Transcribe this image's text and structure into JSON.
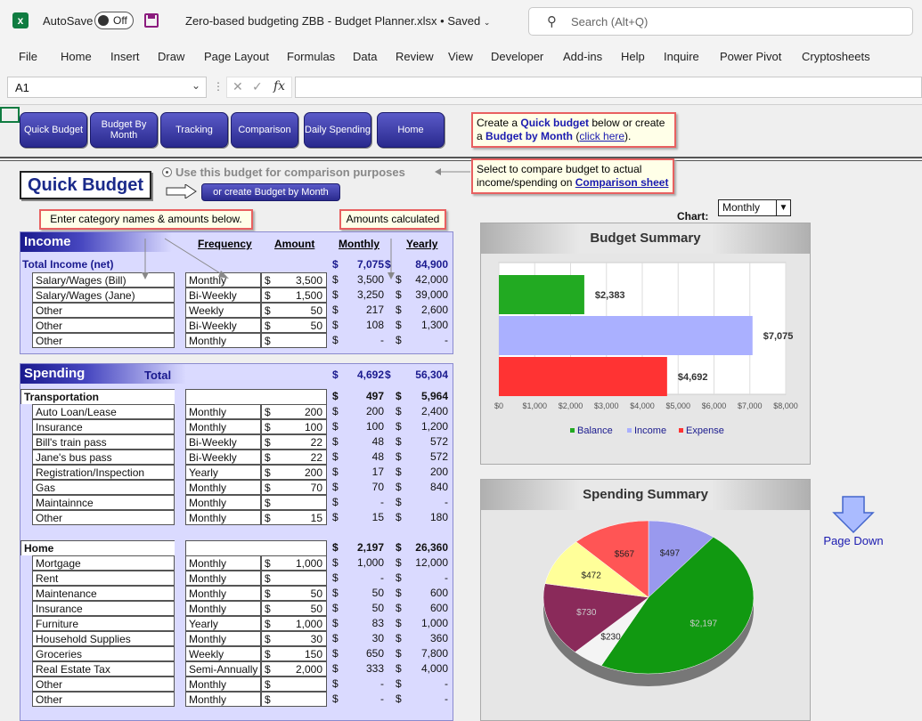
{
  "app": {
    "autosave_label": "AutoSave",
    "autosave_state": "Off",
    "doc_title": "Zero-based budgeting ZBB - Budget Planner.xlsx • Saved",
    "search_placeholder": "Search (Alt+Q)"
  },
  "menu": [
    "File",
    "Home",
    "Insert",
    "Draw",
    "Page Layout",
    "Formulas",
    "Data",
    "Review",
    "View",
    "Developer",
    "Add-ins",
    "Help",
    "Inquire",
    "Power Pivot",
    "Cryptosheets"
  ],
  "formula_bar": {
    "name_box": "A1",
    "fx": "fx",
    "value": ""
  },
  "nav_buttons": [
    "Quick Budget",
    "Budget By Month",
    "Tracking",
    "Comparison",
    "Daily Spending",
    "Home"
  ],
  "notes": {
    "top_1": "Create a ",
    "top_quick": "Quick budget",
    "top_2": " below or create a",
    "top_bbm": "Budget by Month",
    "top_3": " (",
    "top_link": "click here",
    "top_4": ").",
    "compare_1": "Select to compare budget to actual income/spending on ",
    "compare_link": "Comparison sheet",
    "enter_names": "Enter category names & amounts below.",
    "amounts_calc": "Amounts calculated"
  },
  "quick_budget": {
    "title": "Quick Budget",
    "radio_label": "Use this budget for comparison purposes",
    "create_btn": "or create Budget by Month"
  },
  "columns": {
    "frequency": "Frequency",
    "amount": "Amount",
    "monthly": "Monthly",
    "yearly": "Yearly"
  },
  "currency": "$",
  "income": {
    "title": "Income",
    "total_label": "Total Income (net)",
    "total_monthly": "7,075",
    "total_yearly": "84,900",
    "rows": [
      {
        "name": "Salary/Wages (Bill)",
        "freq": "Monthly",
        "amount": "3,500",
        "monthly": "3,500",
        "yearly": "42,000"
      },
      {
        "name": "Salary/Wages (Jane)",
        "freq": "Bi-Weekly",
        "amount": "1,500",
        "monthly": "3,250",
        "yearly": "39,000"
      },
      {
        "name": "Other",
        "freq": "Weekly",
        "amount": "50",
        "monthly": "217",
        "yearly": "2,600"
      },
      {
        "name": "Other",
        "freq": "Bi-Weekly",
        "amount": "50",
        "monthly": "108",
        "yearly": "1,300"
      },
      {
        "name": "Other",
        "freq": "Monthly",
        "amount": "",
        "monthly": "-",
        "yearly": "-"
      }
    ]
  },
  "spending": {
    "title": "Spending",
    "total_label": "Total",
    "total_monthly": "4,692",
    "total_yearly": "56,304",
    "transportation": {
      "label": "Transportation",
      "monthly": "497",
      "yearly": "5,964",
      "rows": [
        {
          "name": "Auto Loan/Lease",
          "freq": "Monthly",
          "amount": "200",
          "monthly": "200",
          "yearly": "2,400"
        },
        {
          "name": "Insurance",
          "freq": "Monthly",
          "amount": "100",
          "monthly": "100",
          "yearly": "1,200"
        },
        {
          "name": "Bill's train pass",
          "freq": "Bi-Weekly",
          "amount": "22",
          "monthly": "48",
          "yearly": "572"
        },
        {
          "name": "Jane's bus pass",
          "freq": "Bi-Weekly",
          "amount": "22",
          "monthly": "48",
          "yearly": "572"
        },
        {
          "name": "Registration/Inspection",
          "freq": "Yearly",
          "amount": "200",
          "monthly": "17",
          "yearly": "200"
        },
        {
          "name": "Gas",
          "freq": "Monthly",
          "amount": "70",
          "monthly": "70",
          "yearly": "840"
        },
        {
          "name": "Maintainnce",
          "freq": "Monthly",
          "amount": "",
          "monthly": "-",
          "yearly": "-"
        },
        {
          "name": "Other",
          "freq": "Monthly",
          "amount": "15",
          "monthly": "15",
          "yearly": "180"
        }
      ]
    },
    "home": {
      "label": "Home",
      "monthly": "2,197",
      "yearly": "26,360",
      "rows": [
        {
          "name": "Mortgage",
          "freq": "Monthly",
          "amount": "1,000",
          "monthly": "1,000",
          "yearly": "12,000"
        },
        {
          "name": "Rent",
          "freq": "Monthly",
          "amount": "",
          "monthly": "-",
          "yearly": "-"
        },
        {
          "name": "Maintenance",
          "freq": "Monthly",
          "amount": "50",
          "monthly": "50",
          "yearly": "600"
        },
        {
          "name": "Insurance",
          "freq": "Monthly",
          "amount": "50",
          "monthly": "50",
          "yearly": "600"
        },
        {
          "name": "Furniture",
          "freq": "Yearly",
          "amount": "1,000",
          "monthly": "83",
          "yearly": "1,000"
        },
        {
          "name": "Household Supplies",
          "freq": "Monthly",
          "amount": "30",
          "monthly": "30",
          "yearly": "360"
        },
        {
          "name": "Groceries",
          "freq": "Weekly",
          "amount": "150",
          "monthly": "650",
          "yearly": "7,800"
        },
        {
          "name": "Real Estate Tax",
          "freq": "Semi-Annually",
          "amount": "2,000",
          "monthly": "333",
          "yearly": "4,000"
        },
        {
          "name": "Other",
          "freq": "Monthly",
          "amount": "",
          "monthly": "-",
          "yearly": "-"
        },
        {
          "name": "Other",
          "freq": "Monthly",
          "amount": "",
          "monthly": "-",
          "yearly": "-"
        }
      ]
    }
  },
  "chart_controls": {
    "label": "Chart:",
    "selected": "Monthly"
  },
  "page_down": "Page Down",
  "colors": {
    "balance": "#22aa22",
    "income": "#aab0ff",
    "expense": "#ff3333",
    "navy": "#1a1a8e"
  },
  "chart_data": [
    {
      "type": "bar",
      "title": "Budget Summary",
      "orientation": "horizontal",
      "categories": [
        "Balance",
        "Income",
        "Expense"
      ],
      "values": [
        2383,
        7075,
        4692
      ],
      "data_labels": [
        "$2,383",
        "$7,075",
        "$4,692"
      ],
      "xlim": [
        0,
        8000
      ],
      "x_ticks": [
        "$0",
        "$1,000",
        "$2,000",
        "$3,000",
        "$4,000",
        "$5,000",
        "$6,000",
        "$7,000",
        "$8,000"
      ],
      "legend": [
        "Balance",
        "Income",
        "Expense"
      ],
      "legend_position": "bottom",
      "grid": true
    },
    {
      "type": "pie",
      "title": "Spending Summary",
      "values": [
        497,
        2197,
        230,
        730,
        472,
        567
      ],
      "labels": [
        "$497",
        "$2,197",
        "$230",
        "$730",
        "$472",
        "$567"
      ],
      "colors": [
        "#9999ee",
        "#119911",
        "#f4f4f4",
        "#8a2a5a",
        "#ffff99",
        "#ff5555"
      ]
    }
  ]
}
